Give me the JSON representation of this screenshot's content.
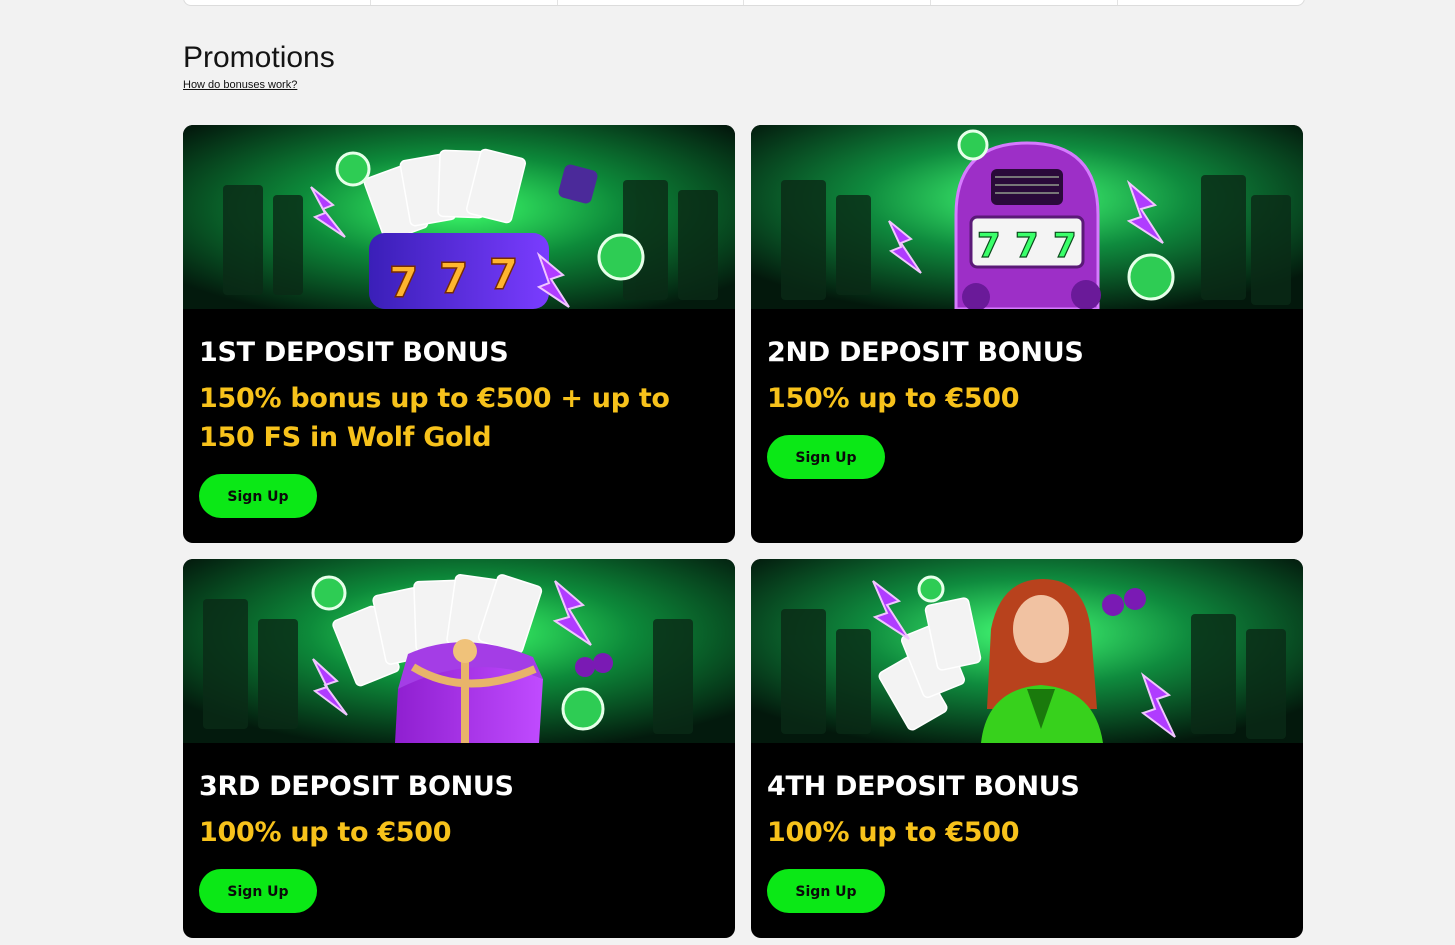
{
  "page": {
    "title": "Promotions",
    "help_link": "How do bonuses work?"
  },
  "colors": {
    "background": "#f2f2f2",
    "card_bg": "#000000",
    "title_text": "#ffffff",
    "offer_text": "#f7c21b",
    "button_bg": "#0be816",
    "button_text": "#0a0a0a"
  },
  "promotions": [
    {
      "title": "1ST DEPOSIT BONUS",
      "offer": "150% bonus up to €500 + up to 150 FS in Wolf Gold",
      "button_label": "Sign Up",
      "image": "cards-and-777-slot-reel"
    },
    {
      "title": "2ND DEPOSIT BONUS",
      "offer": "150% up to €500",
      "button_label": "Sign Up",
      "image": "purple-slot-machine-777"
    },
    {
      "title": "3RD DEPOSIT BONUS",
      "offer": "100% up to €500",
      "button_label": "Sign Up",
      "image": "cards-and-gift-box"
    },
    {
      "title": "4TH DEPOSIT BONUS",
      "offer": "100% up to €500",
      "button_label": "Sign Up",
      "image": "woman-with-cards"
    }
  ]
}
